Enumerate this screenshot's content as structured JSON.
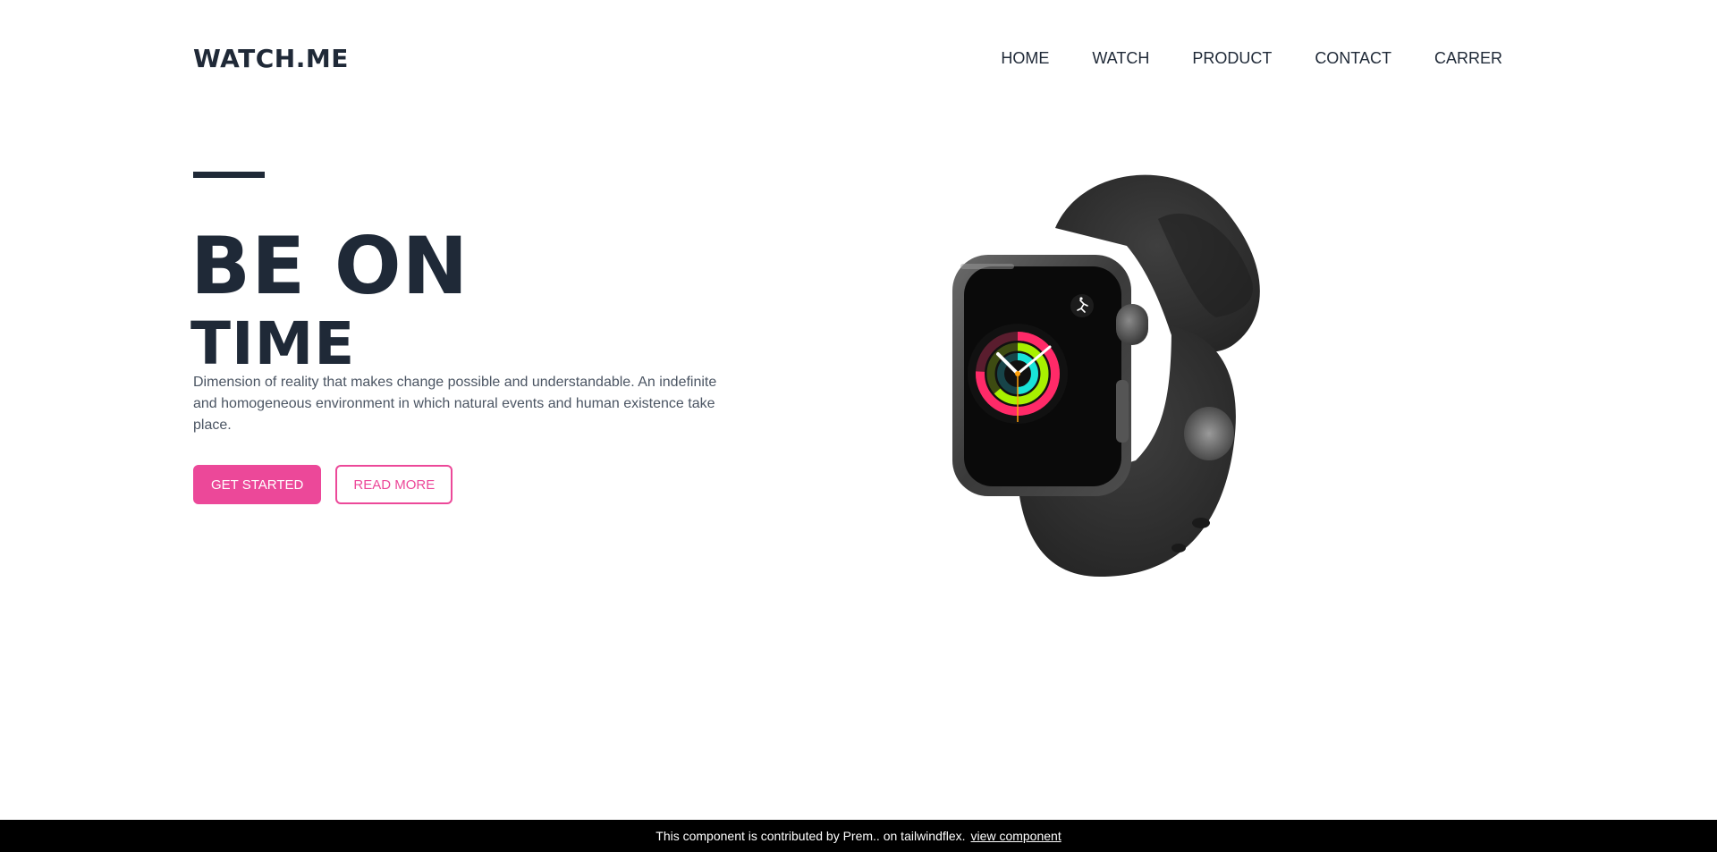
{
  "brand": {
    "logo": "WATCH.ME"
  },
  "nav": {
    "items": [
      {
        "label": "HOME"
      },
      {
        "label": "WATCH"
      },
      {
        "label": "PRODUCT"
      },
      {
        "label": "CONTACT"
      },
      {
        "label": "CARRER"
      }
    ]
  },
  "hero": {
    "title_line1": "BE ON",
    "title_line2": "TIME",
    "description": "Dimension of reality that makes change possible and understandable. An indefinite and homogeneous environment in which natural events and human existence take place.",
    "primary_button": "GET STARTED",
    "secondary_button": "READ MORE"
  },
  "footer": {
    "text": "This component is contributed by Prem.. on tailwindflex.",
    "link": "view component"
  },
  "colors": {
    "text_dark": "#1f2937",
    "accent_pink": "#ec4899",
    "footer_bg": "#000000"
  },
  "icons": {
    "product_image": "smartwatch-image",
    "watch_complication": "running-figure-icon"
  }
}
